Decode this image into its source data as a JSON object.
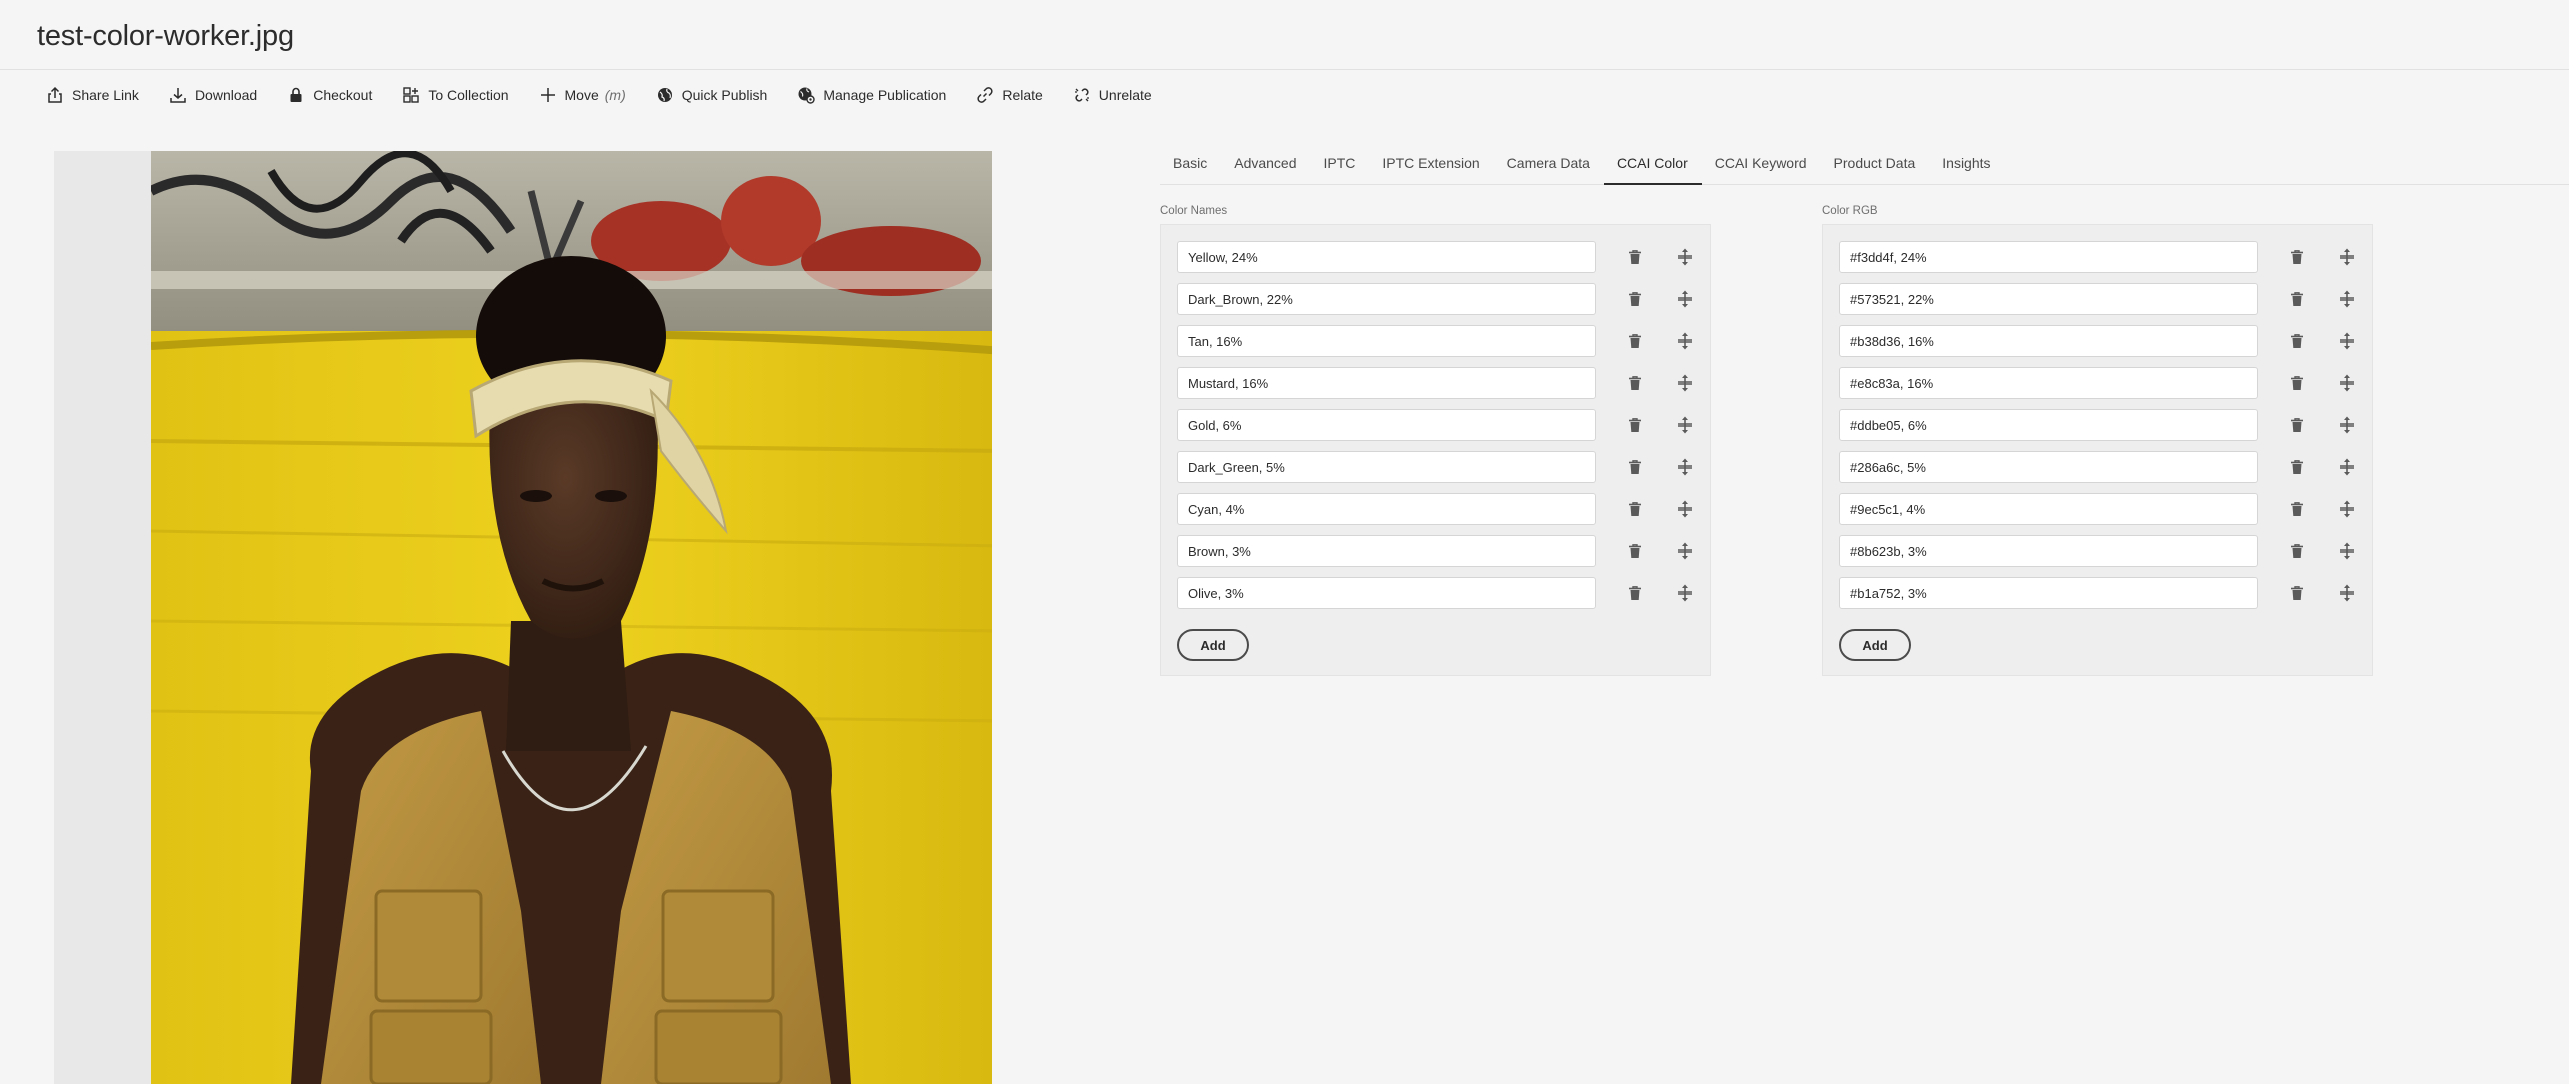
{
  "asset": {
    "title": "test-color-worker.jpg"
  },
  "actions": [
    {
      "label": "Share Link",
      "icon": "share-icon",
      "hint": ""
    },
    {
      "label": "Download",
      "icon": "download-icon",
      "hint": ""
    },
    {
      "label": "Checkout",
      "icon": "lock-icon",
      "hint": ""
    },
    {
      "label": "To Collection",
      "icon": "collection-icon",
      "hint": ""
    },
    {
      "label": "Move",
      "icon": "move-icon",
      "hint": "(m)"
    },
    {
      "label": "Quick Publish",
      "icon": "globe-icon",
      "hint": ""
    },
    {
      "label": "Manage Publication",
      "icon": "manage-globe-icon",
      "hint": ""
    },
    {
      "label": "Relate",
      "icon": "link-icon",
      "hint": ""
    },
    {
      "label": "Unrelate",
      "icon": "unlink-icon",
      "hint": ""
    }
  ],
  "tabs": [
    {
      "label": "Basic"
    },
    {
      "label": "Advanced"
    },
    {
      "label": "IPTC"
    },
    {
      "label": "IPTC Extension"
    },
    {
      "label": "Camera Data"
    },
    {
      "label": "CCAI Color",
      "active": true
    },
    {
      "label": "CCAI Keyword"
    },
    {
      "label": "Product Data"
    },
    {
      "label": "Insights"
    }
  ],
  "color_names": {
    "label": "Color Names",
    "values": [
      "Yellow, 24%",
      "Dark_Brown, 22%",
      "Tan, 16%",
      "Mustard, 16%",
      "Gold, 6%",
      "Dark_Green, 5%",
      "Cyan, 4%",
      "Brown, 3%",
      "Olive, 3%"
    ],
    "add_label": "Add"
  },
  "color_rgb": {
    "label": "Color RGB",
    "values": [
      "#f3dd4f, 24%",
      "#573521, 22%",
      "#b38d36, 16%",
      "#e8c83a, 16%",
      "#ddbe05, 6%",
      "#286a6c, 5%",
      "#9ec5c1, 4%",
      "#8b623b, 3%",
      "#b1a752, 3%"
    ],
    "add_label": "Add"
  },
  "row_icons": {
    "delete": "trash-icon",
    "reorder": "drag-handle-icon"
  },
  "colors": {
    "background": "#f5f5f5",
    "text": "#2c2c2c",
    "wall_yellow": "#e9cc1c",
    "vest_tan": "#b38d36",
    "skin_dark": "#573521"
  }
}
